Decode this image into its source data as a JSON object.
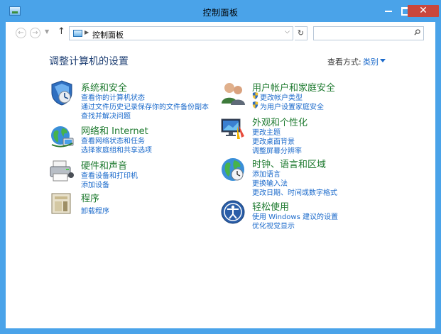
{
  "window": {
    "title": "控制面板"
  },
  "toolbar": {
    "address_path": "控制面板",
    "search_placeholder": ""
  },
  "main": {
    "heading": "调整计算机的设置",
    "view_by_label": "查看方式:",
    "view_by_value": "类别"
  },
  "categories_left": [
    {
      "title": "系统和安全",
      "icon": "system-security-icon",
      "links": [
        "查看你的计算机状态",
        "通过文件历史记录保存你的文件备份副本",
        "查找并解决问题"
      ]
    },
    {
      "title": "网络和 Internet",
      "icon": "network-internet-icon",
      "links": [
        "查看网络状态和任务",
        "选择家庭组和共享选项"
      ]
    },
    {
      "title": "硬件和声音",
      "icon": "hardware-sound-icon",
      "links": [
        "查看设备和打印机",
        "添加设备"
      ]
    },
    {
      "title": "程序",
      "icon": "programs-icon",
      "links": [
        "卸载程序"
      ]
    }
  ],
  "categories_right": [
    {
      "title": "用户帐户和家庭安全",
      "icon": "user-accounts-icon",
      "links": [
        "更改帐户类型",
        "为用户设置家庭安全"
      ]
    },
    {
      "title": "外观和个性化",
      "icon": "appearance-icon",
      "links": [
        "更改主题",
        "更改桌面背景",
        "调整屏幕分辨率"
      ]
    },
    {
      "title": "时钟、语言和区域",
      "icon": "clock-region-icon",
      "links": [
        "添加语言",
        "更换输入法",
        "更改日期、时间或数字格式"
      ]
    },
    {
      "title": "轻松使用",
      "icon": "ease-of-access-icon",
      "links": [
        "使用 Windows 建议的设置",
        "优化视觉显示"
      ]
    }
  ],
  "colors": {
    "title_bar": "#4aa3e9",
    "close_button": "#c9473c",
    "category_title": "#1e7a2f",
    "link": "#1b6acb",
    "heading": "#1e3f73"
  }
}
